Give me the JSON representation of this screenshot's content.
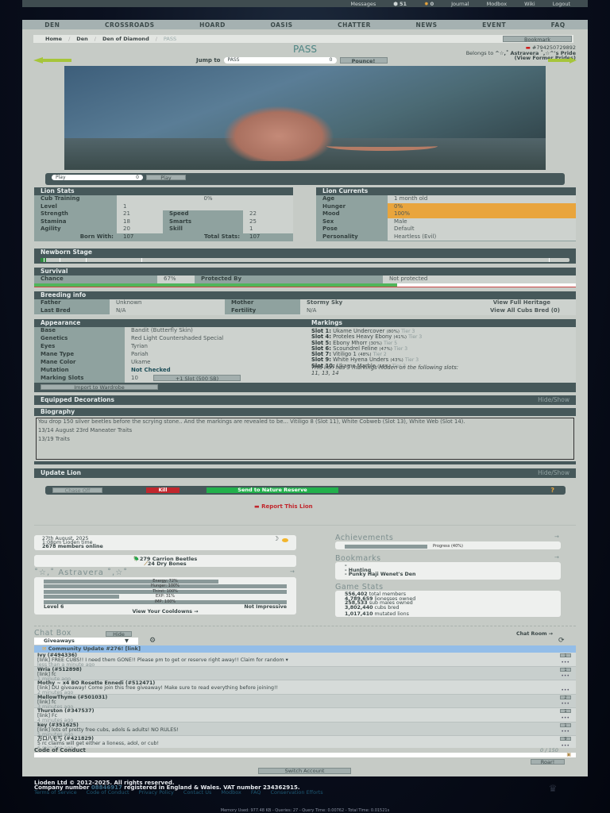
{
  "topbar": {
    "messages": "Messages",
    "count1": "51",
    "count2": "0",
    "journal": "Journal",
    "modbox": "Modbox",
    "wiki": "Wiki",
    "logout": "Logout"
  },
  "nav": [
    "DEN",
    "CROSSROADS",
    "HOARD",
    "OASIS",
    "CHATTER",
    "NEWS",
    "EVENT",
    "FAQ"
  ],
  "breadcrumb": [
    "Home",
    "Den",
    "Den of Diamond",
    "PASS"
  ],
  "bookmark": "Bookmark",
  "title": "PASS",
  "lion_id": "#794250729892",
  "belongs_to_label": "Belongs to",
  "owner": "^☆,˚ Astravera ˚,☆^'s Pride",
  "former_prides": "(View Former Prides)",
  "jump": {
    "label": "Jump to",
    "value": "PASS",
    "count": "0",
    "button": "Pounce!"
  },
  "play": {
    "value": "Play",
    "count": "0",
    "button": "Play"
  },
  "stats": {
    "title": "Lion Stats",
    "cub_training_label": "Cub Training",
    "cub_training": "0%",
    "level_label": "Level",
    "level": "1",
    "rows": [
      {
        "l": "Strength",
        "v": "21",
        "l2": "Speed",
        "v2": "22"
      },
      {
        "l": "Stamina",
        "v": "18",
        "l2": "Smarts",
        "v2": "25"
      },
      {
        "l": "Agility",
        "v": "20",
        "l2": "Skill",
        "v2": "1"
      }
    ],
    "born_label": "Born With:",
    "born": "107",
    "total_label": "Total Stats:",
    "total": "107"
  },
  "currents": {
    "title": "Lion Currents",
    "rows": [
      {
        "l": "Age",
        "v": "1 month old"
      },
      {
        "l": "Hunger",
        "v": "0%"
      },
      {
        "l": "Mood",
        "v": "100%"
      },
      {
        "l": "Sex",
        "v": "Male"
      },
      {
        "l": "Pose",
        "v": "Default"
      },
      {
        "l": "Personality",
        "v": "Heartless (Evil)"
      }
    ],
    "highlight": "#e9a53d"
  },
  "newborn": {
    "title": "Newborn Stage",
    "progress": 0.01
  },
  "survival": {
    "title": "Survival",
    "chance_label": "Chance",
    "chance": "67%",
    "chance_value": 0.67,
    "protected_label": "Protected By",
    "protected": "Not protected"
  },
  "breeding": {
    "title": "Breeding info",
    "father_label": "Father",
    "father": "Unknown",
    "mother_label": "Mother",
    "mother": "Stormy Sky",
    "heritage": "View Full Heritage",
    "last_bred_label": "Last Bred",
    "last_bred": "N/A",
    "fertility_label": "Fertility",
    "fertility": "N/A",
    "cubs": "View All Cubs Bred (0)"
  },
  "appearance": {
    "title": "Appearance",
    "rows": [
      {
        "l": "Base",
        "v": "Bandit (Butterfly Skin)"
      },
      {
        "l": "Genetics",
        "v": "Red Light Countershaded Special"
      },
      {
        "l": "Eyes",
        "v": "Tyrian"
      },
      {
        "l": "Mane Type",
        "v": "Pariah"
      },
      {
        "l": "Mane Color",
        "v": "Ukame"
      },
      {
        "l": "Mutation",
        "v": "Not Checked"
      },
      {
        "l": "Marking Slots",
        "v": "10"
      }
    ],
    "slot_button": "+1 Slot (500 SB)",
    "import": "Import to Wardrobe"
  },
  "markings": {
    "title": "Markings",
    "items": [
      {
        "slot": "Slot 1:",
        "name": "Ukame Undercover",
        "pct": "(80%)",
        "tier": "Tier 3"
      },
      {
        "slot": "Slot 4:",
        "name": "Proteles Heavy Ebony",
        "pct": "(41%)",
        "tier": "Tier 3"
      },
      {
        "slot": "Slot 5:",
        "name": "Ebony Mhorr",
        "pct": "(30%)",
        "tier": "Tier 5"
      },
      {
        "slot": "Slot 6:",
        "name": "Scoundrel Feline",
        "pct": "(47%)",
        "tier": "Tier 3"
      },
      {
        "slot": "Slot 7:",
        "name": "Vitiligo 1",
        "pct": "(48%)",
        "tier": "Tier 2"
      },
      {
        "slot": "Slot 9:",
        "name": "White Hyena Unders",
        "pct": "(43%)",
        "tier": "Tier 3"
      },
      {
        "slot": "Slot 10:",
        "name": "Ukame Marble",
        "pct": "(16%)",
        "tier": "Tier 3"
      }
    ],
    "hidden": "This lion has 3 markings hidden on the following slots:",
    "hidden_slots": "11, 13, 14"
  },
  "decorations": {
    "title": "Equipped Decorations",
    "toggle": "Hide/Show"
  },
  "biography": {
    "title": "Biography",
    "lines": [
      "You drop 150 silver beetles before the scrying stone.. And the markings are revealed to be... Vitiligo 8 (Slot 11), White Cobweb (Slot 13), White Web (Slot 14).",
      "13/14 August 23rd Maneater Traits",
      "13/19 Traits"
    ]
  },
  "update": {
    "title": "Update Lion",
    "toggle": "Hide/Show",
    "chase": "Chase Off",
    "kill": "Kill",
    "reserve": "Send to Nature Reserve"
  },
  "report": "Report This Lion",
  "info": {
    "date": "27th August, 2025",
    "time": "1:08pm Lioden time",
    "online": "2678 members online"
  },
  "currency": {
    "beetles": "279 Carrion Beetles",
    "bones": "24 Dry Bones"
  },
  "user": {
    "name": "˚☆,˚ Astravera ˚,☆˚",
    "arrow": "→",
    "bars": [
      {
        "label": "Energy: 72%",
        "value": 0.72
      },
      {
        "label": "Hunger: 100%",
        "value": 1
      },
      {
        "label": "Thirst: 100%",
        "value": 1
      },
      {
        "label": "EXP: 31%",
        "value": 0.31
      },
      {
        "label": "IMP: 100%",
        "value": 1
      }
    ],
    "level": "Level 6",
    "impress": "Not Impressive",
    "cooldowns": "View Your Cooldowns →"
  },
  "achievements": {
    "title": "Achievements",
    "progress_label": "Progress (40%)",
    "progress": 0.4,
    "arrow": "→"
  },
  "bookmarks": {
    "title": "Bookmarks",
    "arrow": "→",
    "items": [
      "-",
      "- Hunting",
      "- Punky Haji Wenet's Den"
    ]
  },
  "game_stats": {
    "title": "Game Stats",
    "items": [
      {
        "n": "556,402",
        "t": "total members"
      },
      {
        "n": "4,789,659",
        "t": "lionesses owned"
      },
      {
        "n": "258,533",
        "t": "sub males owned"
      },
      {
        "n": "3,802,440",
        "t": "cubs bred"
      },
      {
        "n": "1,017,410",
        "t": "mutated lions"
      }
    ]
  },
  "chat": {
    "title": "Chat Box",
    "hide": "Hide",
    "room_link": "Chat Room →",
    "room": "Giveaways",
    "announcement": "Community Update #276! [link]",
    "messages": [
      {
        "user": "Ivy (#494336)",
        "text": "[link] FREE CUBS!! I need them GONE!! Please pm to get or reserve right away!! Claim for random ▾",
        "time": "less than a minute ago",
        "count": "1"
      },
      {
        "user": "Wria (#512898)",
        "text": "[link] fc",
        "time": "1 minute ago",
        "count": "1"
      },
      {
        "user": "Mothy ~ x4 BO Rosette Ennedi (#512471)",
        "text": "[link] DU giveaway! Come join this free giveaway! Make sure to read everything before joining!!",
        "time": "2 minutes ago",
        "count": ""
      },
      {
        "user": "MellowThyme (#501031)",
        "text": "[link] fc",
        "time": "3 minutes ago",
        "count": "2"
      },
      {
        "user": "Thurston (#347537)",
        "text": "[link] Fc",
        "time": "4 minutes ago",
        "count": "1"
      },
      {
        "user": "key (#351625)",
        "text": "[link] lots of pretty free cubs, adols & adults! NO RULES!",
        "time": "5 minutes ago",
        "count": "1"
      },
      {
        "user": "万ロ八モ丂 (#421829)",
        "text": "5 rc claims will get either a lioness, adol, or cub!",
        "time": "6 minutes ago",
        "count": "9"
      }
    ],
    "conduct": "Code of Conduct",
    "counter": "0 / 150",
    "roar": "Roar!"
  },
  "switch": "Switch Account",
  "footer": {
    "line1": "Lioden Ltd © 2012-2025. All rights reserved.",
    "line2a": "Company number",
    "company": "08846917",
    "line2b": "registered in England & Wales. VAT number 234362915.",
    "links": [
      "Terms of Service",
      "Code of Conduct",
      "Privacy Policy",
      "Contact Us",
      "Modbox",
      "FAQ",
      "Conservation Efforts"
    ],
    "memory": "Memory Used: 977.48 KB - Queries: 27 - Query Time: 0.00762 - Total Time: 0.01521s"
  }
}
